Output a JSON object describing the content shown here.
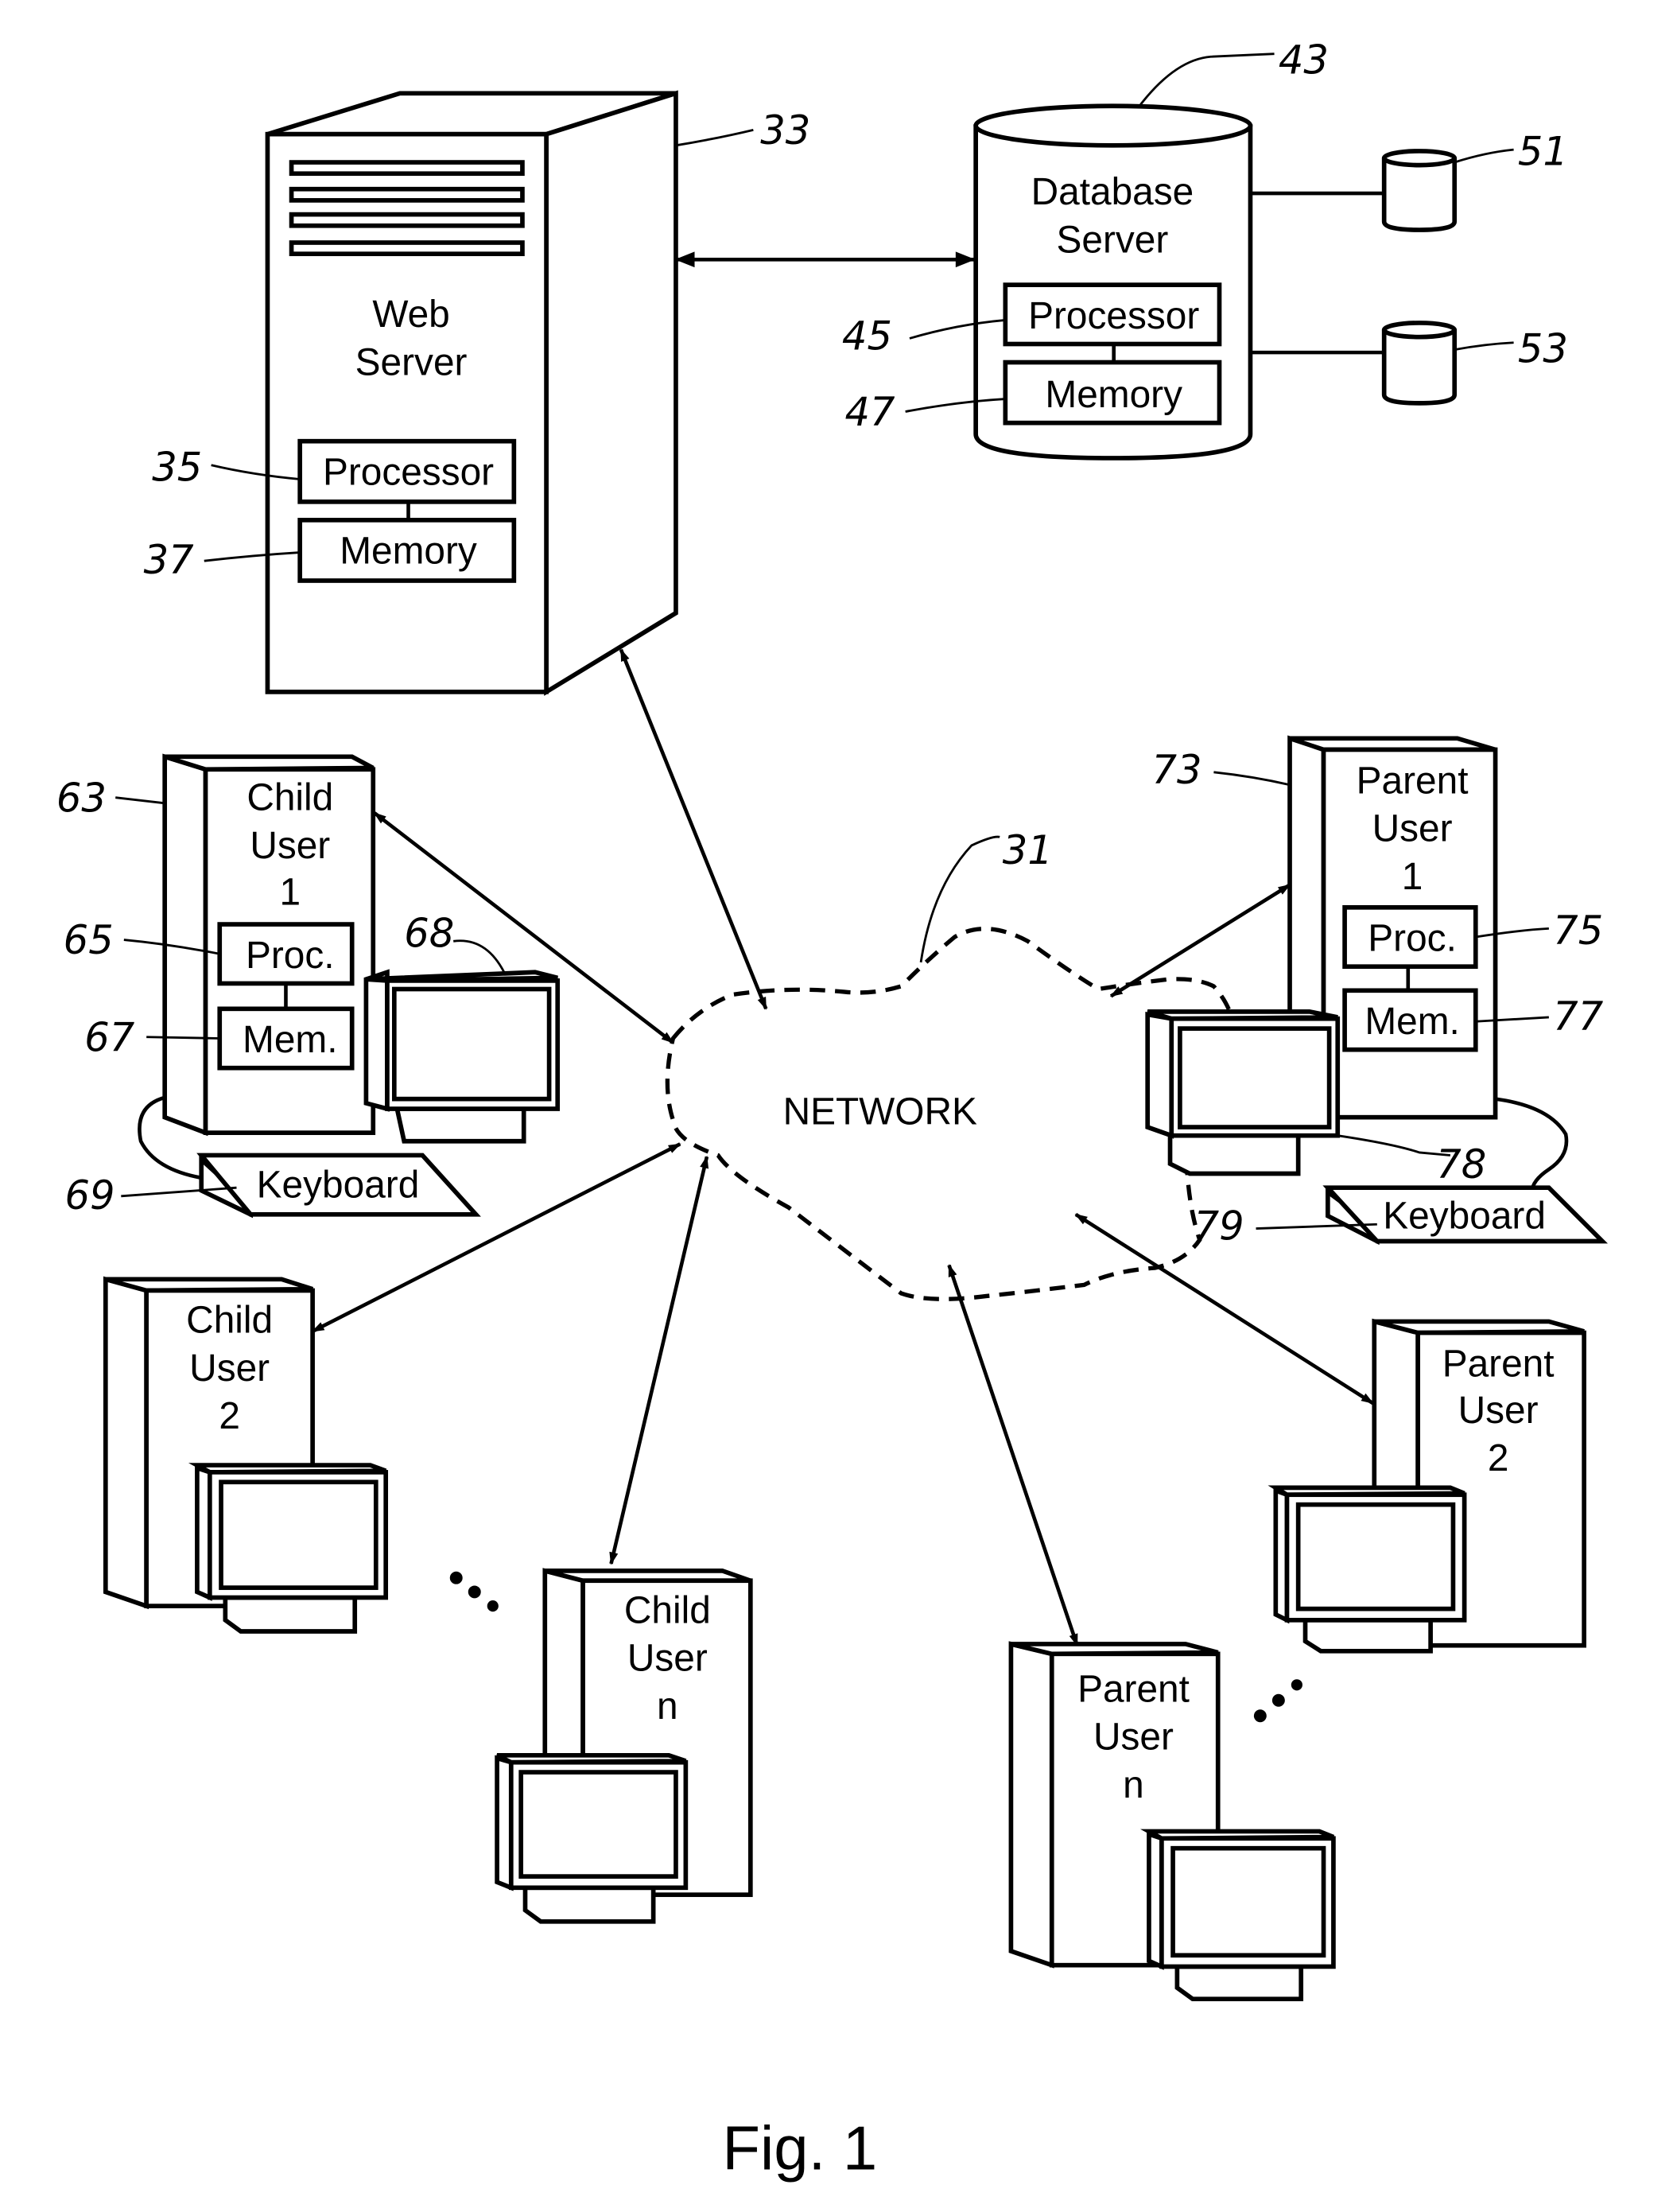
{
  "figure": {
    "caption": "Fig. 1",
    "network": {
      "label": "NETWORK",
      "ref": "31"
    },
    "web_server": {
      "title_line1": "Web",
      "title_line2": "Server",
      "ref": "33",
      "processor": {
        "label": "Processor",
        "ref": "35"
      },
      "memory": {
        "label": "Memory",
        "ref": "37"
      }
    },
    "database_server": {
      "title_line1": "Database",
      "title_line2": "Server",
      "ref": "43",
      "processor": {
        "label": "Processor",
        "ref": "45"
      },
      "memory": {
        "label": "Memory",
        "ref": "47"
      },
      "storage": [
        {
          "ref": "51"
        },
        {
          "ref": "53"
        }
      ]
    },
    "child_user_1": {
      "line1": "Child",
      "line2": "User",
      "line3": "1",
      "ref": "63",
      "processor": {
        "label": "Proc.",
        "ref": "65"
      },
      "memory": {
        "label": "Mem.",
        "ref": "67"
      },
      "monitor_ref": "68",
      "keyboard": {
        "label": "Keyboard",
        "ref": "69"
      }
    },
    "parent_user_1": {
      "line1": "Parent",
      "line2": "User",
      "line3": "1",
      "ref": "73",
      "processor": {
        "label": "Proc.",
        "ref": "75"
      },
      "memory": {
        "label": "Mem.",
        "ref": "77"
      },
      "monitor_ref": "78",
      "keyboard": {
        "label": "Keyboard",
        "ref": "79"
      }
    },
    "child_user_2": {
      "line1": "Child",
      "line2": "User",
      "line3": "2"
    },
    "child_user_n": {
      "line1": "Child",
      "line2": "User",
      "line3": "n"
    },
    "parent_user_2": {
      "line1": "Parent",
      "line2": "User",
      "line3": "2"
    },
    "parent_user_n": {
      "line1": "Parent",
      "line2": "User",
      "line3": "n"
    },
    "ellipsis": "..."
  }
}
